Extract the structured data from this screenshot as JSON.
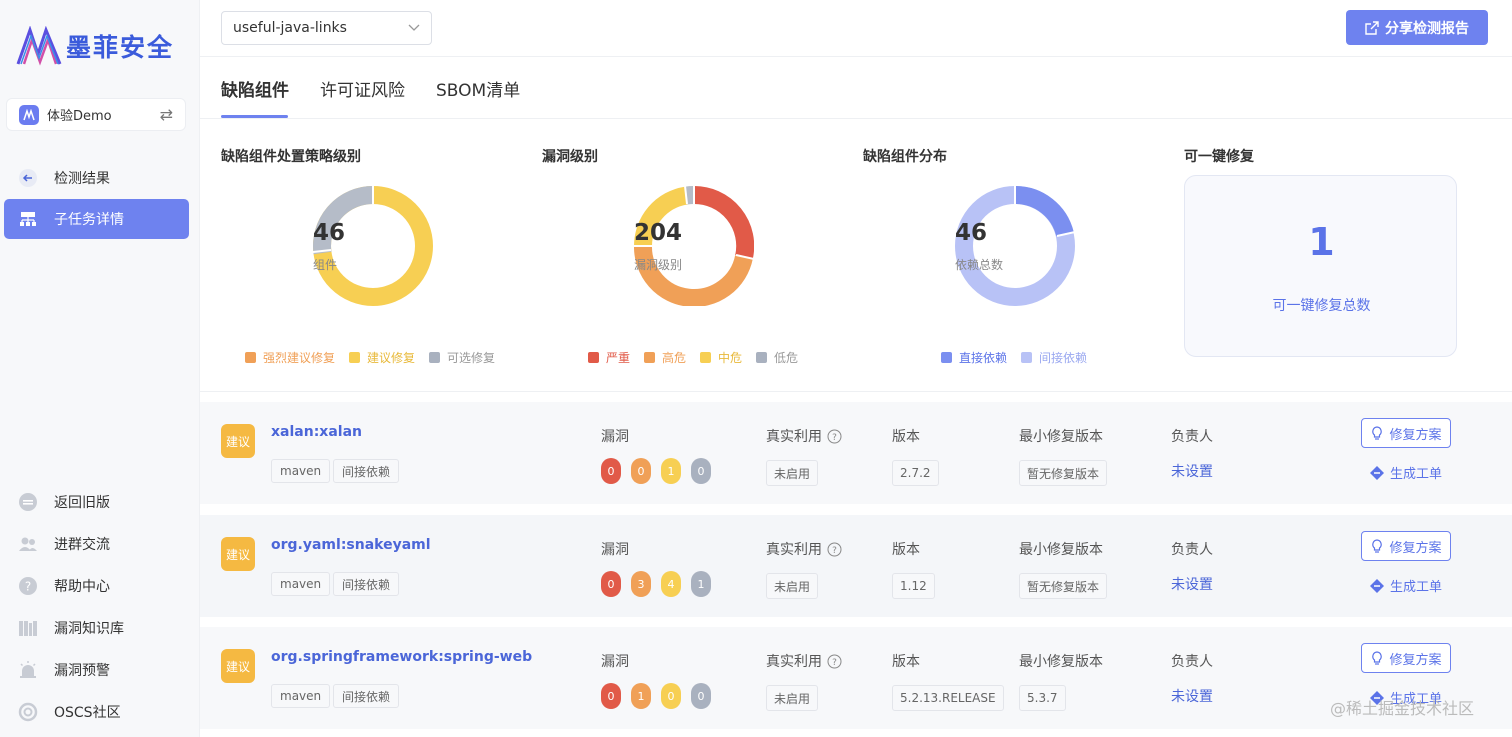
{
  "sidebar": {
    "logo_text": "墨菲安全",
    "project_name": "体验Demo",
    "back_label": "检测结果",
    "active_label": "子任务详情",
    "bottom_items": [
      {
        "label": "返回旧版",
        "icon": "minus-circle-icon"
      },
      {
        "label": "进群交流",
        "icon": "users-icon"
      },
      {
        "label": "帮助中心",
        "icon": "help-circle-icon"
      },
      {
        "label": "漏洞知识库",
        "icon": "books-icon"
      },
      {
        "label": "漏洞预警",
        "icon": "alarm-icon"
      },
      {
        "label": "OSCS社区",
        "icon": "community-icon"
      }
    ]
  },
  "header": {
    "repo_select": "useful-java-links",
    "share_button": "分享检测报告"
  },
  "tabs": [
    "缺陷组件",
    "许可证风险",
    "SBOM清单"
  ],
  "stats": {
    "policy": {
      "title": "缺陷组件处置策略级别",
      "total": "46",
      "label": "组件",
      "legend": [
        {
          "label": "强烈建议修复",
          "color": "#f0a057"
        },
        {
          "label": "建议修复",
          "color": "#f7cf53"
        },
        {
          "label": "可选修复",
          "color": "#a9b1bf"
        }
      ]
    },
    "severity": {
      "title": "漏洞级别",
      "total": "204",
      "label": "漏洞级别",
      "legend": [
        {
          "label": "严重",
          "color": "#e15a48"
        },
        {
          "label": "高危",
          "color": "#f0a057"
        },
        {
          "label": "中危",
          "color": "#f7cf53"
        },
        {
          "label": "低危",
          "color": "#a9b1bf"
        }
      ]
    },
    "distribution": {
      "title": "缺陷组件分布",
      "total": "46",
      "label": "依赖总数",
      "legend": [
        {
          "label": "直接依赖",
          "color": "#7b8ff0"
        },
        {
          "label": "间接依赖",
          "color": "#b8c2f6"
        }
      ]
    },
    "onekey": {
      "title": "可一键修复",
      "value": "1",
      "label": "可一键修复总数"
    }
  },
  "columns": {
    "vuln": "漏洞",
    "exploit": "真实利用",
    "version": "版本",
    "min_fix": "最小修复版本",
    "owner": "负责人"
  },
  "rows": [
    {
      "advice": "建议",
      "name": "xalan:xalan",
      "tag1": "maven",
      "tag2": "间接依赖",
      "vulns": [
        "0",
        "0",
        "1",
        "0"
      ],
      "exploit": "未启用",
      "version": "2.7.2",
      "min_fix": "暂无修复版本",
      "owner": "未设置",
      "fix_btn": "修复方案",
      "gen_btn": "生成工单"
    },
    {
      "advice": "建议",
      "name": "org.yaml:snakeyaml",
      "tag1": "maven",
      "tag2": "间接依赖",
      "vulns": [
        "0",
        "3",
        "4",
        "1"
      ],
      "exploit": "未启用",
      "version": "1.12",
      "min_fix": "暂无修复版本",
      "owner": "未设置",
      "fix_btn": "修复方案",
      "gen_btn": "生成工单"
    },
    {
      "advice": "建议",
      "name": "org.springframework:spring-web",
      "tag1": "maven",
      "tag2": "间接依赖",
      "vulns": [
        "0",
        "1",
        "0",
        "0"
      ],
      "exploit": "未启用",
      "version": "5.2.13.RELEASE",
      "min_fix": "5.3.7",
      "owner": "未设置",
      "fix_btn": "修复方案",
      "gen_btn": "生成工单"
    }
  ],
  "watermark": "@稀土掘金技术社区"
}
